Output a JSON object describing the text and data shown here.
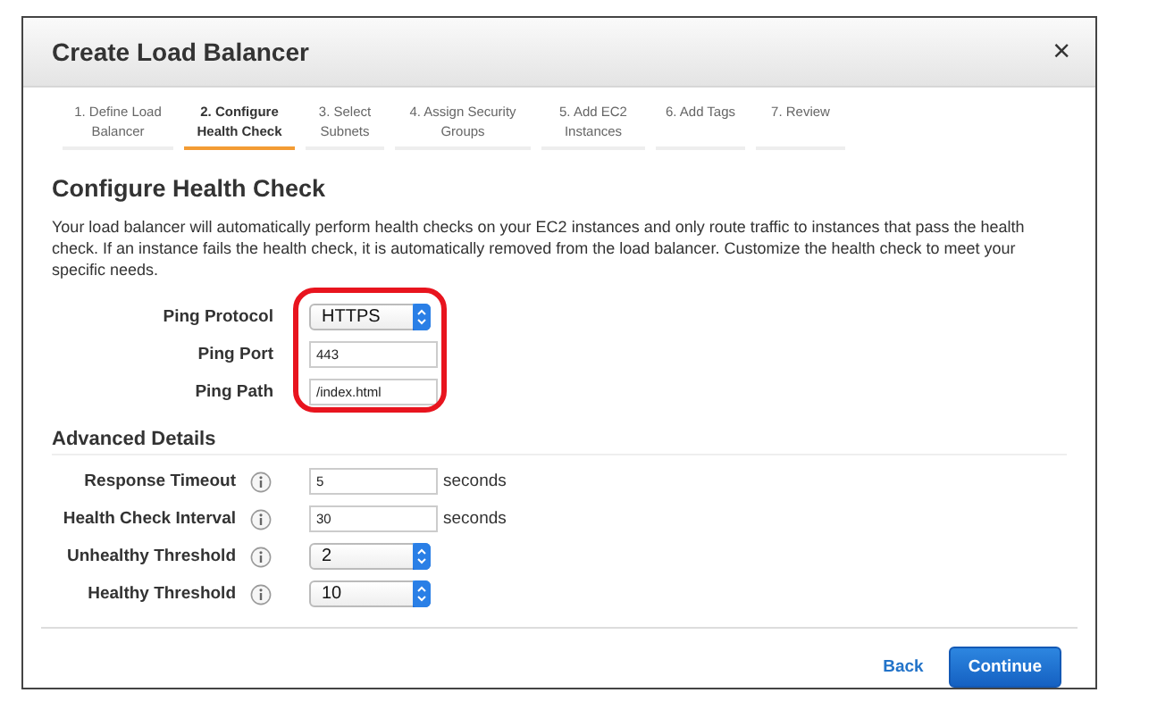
{
  "dialog": {
    "title": "Create Load Balancer",
    "close": "×"
  },
  "steps": [
    {
      "label": "1. Define Load Balancer",
      "selected": false
    },
    {
      "label": "2. Configure Health Check",
      "selected": true
    },
    {
      "label": "3. Select Subnets",
      "selected": false
    },
    {
      "label": "4. Assign Security Groups",
      "selected": false
    },
    {
      "label": "5. Add EC2 Instances",
      "selected": false
    },
    {
      "label": "6. Add Tags",
      "selected": false
    },
    {
      "label": "7. Review",
      "selected": false
    }
  ],
  "heading": "Configure Health Check",
  "description": "Your load balancer will automatically perform health checks on your EC2 instances and only route traffic to instances that pass the health check. If an instance fails the health check, it is automatically removed from the load balancer. Customize the health check to meet your specific needs.",
  "ping": {
    "highlighted": true,
    "fields": [
      {
        "label": "Ping Protocol",
        "kind": "select",
        "value": "HTTPS"
      },
      {
        "label": "Ping Port",
        "kind": "text",
        "value": "443"
      },
      {
        "label": "Ping Path",
        "kind": "text",
        "value": "/index.html"
      }
    ]
  },
  "advanced": {
    "title": "Advanced Details",
    "fields": [
      {
        "label": "Response Timeout",
        "kind": "text",
        "value": "5",
        "unit": "seconds"
      },
      {
        "label": "Health Check Interval",
        "kind": "text",
        "value": "30",
        "unit": "seconds"
      },
      {
        "label": "Unhealthy Threshold",
        "kind": "select",
        "value": "2"
      },
      {
        "label": "Healthy Threshold",
        "kind": "select",
        "value": "10"
      }
    ]
  },
  "buttons": {
    "back": "Back",
    "continue": "Continue"
  }
}
